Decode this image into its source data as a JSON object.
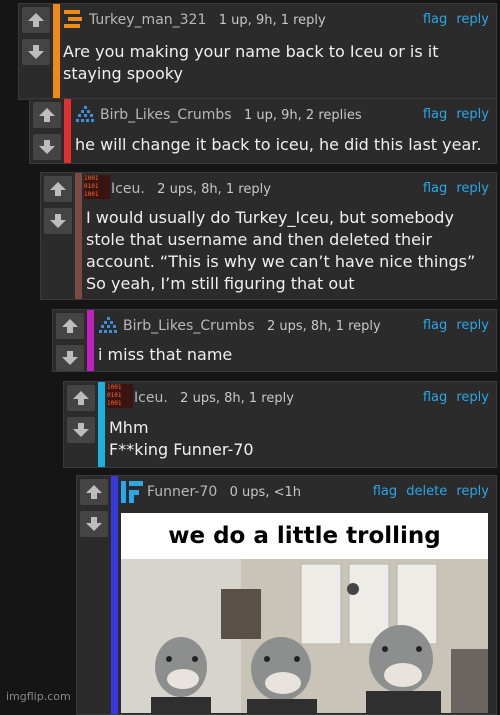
{
  "colors": {
    "background": "#151515",
    "panel": "#2b2b2b",
    "link": "#29a7e8",
    "accent_orange": "#f08a12",
    "accent_red": "#e03030",
    "accent_brown": "#7a4a45",
    "accent_magenta": "#c020c0",
    "accent_cyan": "#20b0e0",
    "accent_blue": "#3838e0"
  },
  "vote_icons": {
    "up": "arrow-up-icon",
    "down": "arrow-down-icon"
  },
  "comments": [
    {
      "username": "Turkey_man_321",
      "stats": "1 up, 9h, 1 reply",
      "actions": {
        "flag": "flag",
        "reply": "reply"
      },
      "text": "Are you making your name back to Iceu or is it\nstaying spooky",
      "avatar": "orange-stripes-avatar"
    },
    {
      "username": "Birb_Likes_Crumbs",
      "stats": "1 up, 9h, 2 replies",
      "actions": {
        "flag": "flag",
        "reply": "reply"
      },
      "text": "he will change it back to iceu, he did this last year.",
      "avatar": "blue-triangle-avatar"
    },
    {
      "username": "Iceu.",
      "stats": "2 ups, 8h, 1 reply",
      "actions": {
        "flag": "flag",
        "reply": "reply"
      },
      "text": "I would usually do Turkey_Iceu, but somebody\nstole that username and then deleted their\naccount. “This is why we can’t have nice things”\nSo yeah, I’m still figuring that out",
      "avatar": "binary-avatar"
    },
    {
      "username": "Birb_Likes_Crumbs",
      "stats": "2 ups, 8h, 1 reply",
      "actions": {
        "flag": "flag",
        "reply": "reply"
      },
      "text": "i miss that name",
      "avatar": "blue-triangle-avatar"
    },
    {
      "username": "Iceu.",
      "stats": "2 ups, 8h, 1 reply",
      "actions": {
        "flag": "flag",
        "reply": "reply"
      },
      "text": "Mhm\nF**king Funner-70",
      "avatar": "binary-avatar"
    },
    {
      "username": "Funner-70",
      "stats": "0 ups, <1h",
      "actions": {
        "flag": "flag",
        "delete": "delete",
        "reply": "reply"
      },
      "avatar": "blue-f-avatar",
      "image": {
        "caption": "we do a little trolling",
        "subject": "shark-people-in-office-image"
      }
    }
  ],
  "avatar_text": {
    "binary": "1001\n0101\n1001"
  },
  "watermark": "imgflip.com"
}
